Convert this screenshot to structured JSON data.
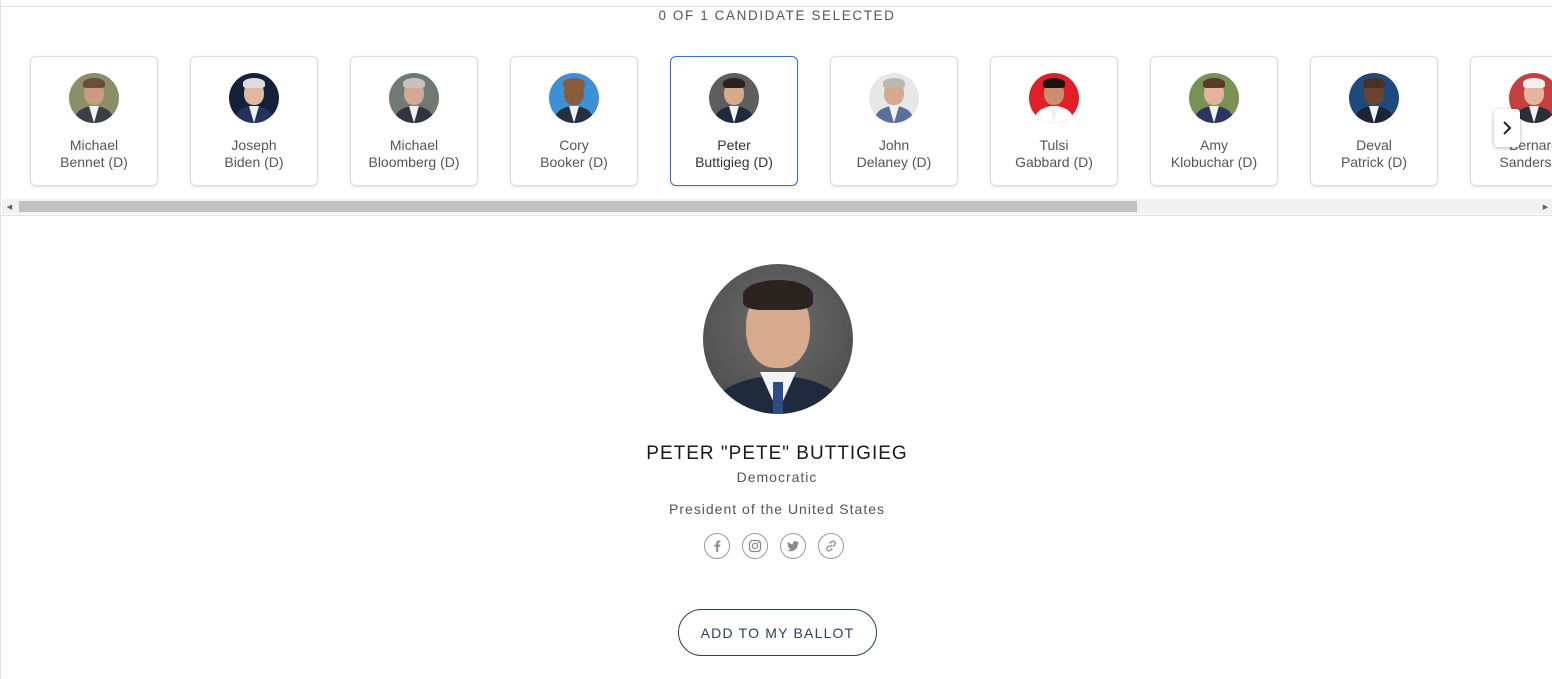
{
  "selection_status": "0 OF 1 CANDIDATE SELECTED",
  "candidates": [
    {
      "first": "Michael",
      "last": "Bennet (D)",
      "bg": "#8a8f6a",
      "skin": "#c99b80",
      "hair": "#6b4e3a",
      "suit": "#3a3f4a"
    },
    {
      "first": "Joseph",
      "last": "Biden (D)",
      "bg": "#15213a",
      "skin": "#e0b8a0",
      "hair": "#dcdcdc",
      "suit": "#25335a"
    },
    {
      "first": "Michael",
      "last": "Bloomberg (D)",
      "bg": "#6f7a72",
      "skin": "#d3a994",
      "hair": "#c6c1bb",
      "suit": "#2f3440"
    },
    {
      "first": "Cory",
      "last": "Booker (D)",
      "bg": "#3d8fd6",
      "skin": "#8a5a3c",
      "hair": "#8a5a3c",
      "suit": "#27303e"
    },
    {
      "first": "Peter",
      "last": "Buttigieg (D)",
      "bg": "#5e5e5e",
      "skin": "#d6a98d",
      "hair": "#2b2320",
      "suit": "#1f2a3d"
    },
    {
      "first": "John",
      "last": "Delaney (D)",
      "bg": "#e7e7e7",
      "skin": "#d8a88e",
      "hair": "#bdb7b1",
      "suit": "#5a6f9c"
    },
    {
      "first": "Tulsi",
      "last": "Gabbard (D)",
      "bg": "#e01f26",
      "skin": "#c98e6e",
      "hair": "#1c1410",
      "suit": "#ffffff"
    },
    {
      "first": "Amy",
      "last": "Klobuchar (D)",
      "bg": "#7a9156",
      "skin": "#e2b49c",
      "hair": "#5a3b26",
      "suit": "#2c3560"
    },
    {
      "first": "Deval",
      "last": "Patrick (D)",
      "bg": "#1f4a7d",
      "skin": "#6a4430",
      "hair": "#4a3020",
      "suit": "#1d2434"
    },
    {
      "first": "Bernard",
      "last": "Sanders (I)",
      "bg": "#c44040",
      "skin": "#e3b59d",
      "hair": "#f0f0f0",
      "suit": "#2a2f3a"
    }
  ],
  "active_index": 4,
  "detail": {
    "name": "PETER \"PETE\" BUTTIGIEG",
    "party": "Democratic",
    "office": "President of the United States"
  },
  "socials": [
    {
      "icon": "facebook-icon"
    },
    {
      "icon": "instagram-icon"
    },
    {
      "icon": "twitter-icon"
    },
    {
      "icon": "website-link-icon"
    }
  ],
  "add_button_label": "ADD TO MY BALLOT",
  "colors": {
    "accent": "#27415e",
    "active_border": "#3b6fc9"
  }
}
